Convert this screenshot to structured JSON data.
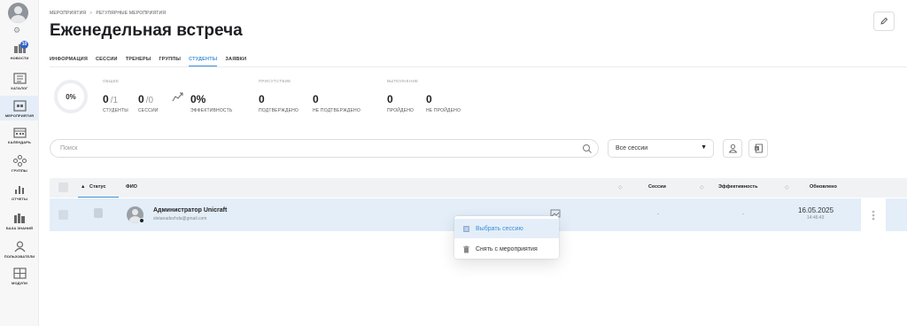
{
  "sidebar": {
    "badge": "10",
    "items": [
      {
        "label": "НОВОСТИ",
        "icon": "news-icon"
      },
      {
        "label": "КАТАЛОГ",
        "icon": "catalog-icon"
      },
      {
        "label": "МЕРОПРИЯТИЯ",
        "icon": "events-icon"
      },
      {
        "label": "КАЛЕНДАРЬ",
        "icon": "calendar-icon"
      },
      {
        "label": "ГРУППЫ",
        "icon": "groups-icon"
      },
      {
        "label": "ОТЧЕТЫ",
        "icon": "reports-icon"
      },
      {
        "label": "БАЗА ЗНАНИЙ",
        "icon": "knowledge-base-icon"
      },
      {
        "label": "ПОЛЬЗОВАТЕЛИ",
        "icon": "users-icon"
      },
      {
        "label": "МОДУЛИ",
        "icon": "modules-icon"
      }
    ]
  },
  "breadcrumbs": {
    "first": "МЕРОПРИЯТИЯ",
    "sep": ">",
    "second": "РЕГУЛЯРНЫЕ МЕРОПРИЯТИЯ"
  },
  "page_title": "Еженедельная встреча",
  "tabs": [
    "ИНФОРМАЦИЯ",
    "СЕССИИ",
    "ТРЕНЕРЫ",
    "ГРУППЫ",
    "СТУДЕНТЫ",
    "ЗАЯВКИ"
  ],
  "active_tab": "СТУДЕНТЫ",
  "stats": {
    "donut": "0%",
    "general_label": "ОБЩЕЕ",
    "students": {
      "num": "0",
      "den": "/1",
      "label": "СТУДЕНТЫ"
    },
    "sessions": {
      "num": "0",
      "den": "/0",
      "label": "СЕССИИ"
    },
    "efficiency": {
      "num": "0%",
      "label": "ЭФФЕКТИВНОСТЬ"
    },
    "attendance_label": "ПРИСУТСТВИЕ",
    "confirmed": {
      "num": "0",
      "label": "ПОДТВЕРЖДЕНО"
    },
    "unconfirmed": {
      "num": "0",
      "label": "НЕ ПОДТВЕРЖДЕНО"
    },
    "completion_label": "ВЫПОЛНЕНИЕ",
    "passed": {
      "num": "0",
      "label": "ПРОЙДЕНО"
    },
    "not_passed": {
      "num": "0",
      "label": "НЕ ПРОЙДЕНО"
    }
  },
  "search": {
    "placeholder": "Поиск"
  },
  "session_filter": {
    "value": "Все сессии"
  },
  "table": {
    "columns": {
      "status": "Статус",
      "name": "ФИО",
      "sessions": "Сессии",
      "efficiency": "Эффективность",
      "updated": "Обновлено"
    },
    "rows": [
      {
        "name": "Администратор Unicraft",
        "email": "sletanadezhda@gmail.com",
        "sessions": "-",
        "efficiency": "-",
        "date": "16.05.2025",
        "time": "14:46:43"
      }
    ]
  },
  "context_menu": {
    "select_session": "Выбрать сессию",
    "remove": "Снять с мероприятия"
  },
  "colors": {
    "accent": "#3a8fd8",
    "row_highlight": "#e3eef9"
  }
}
